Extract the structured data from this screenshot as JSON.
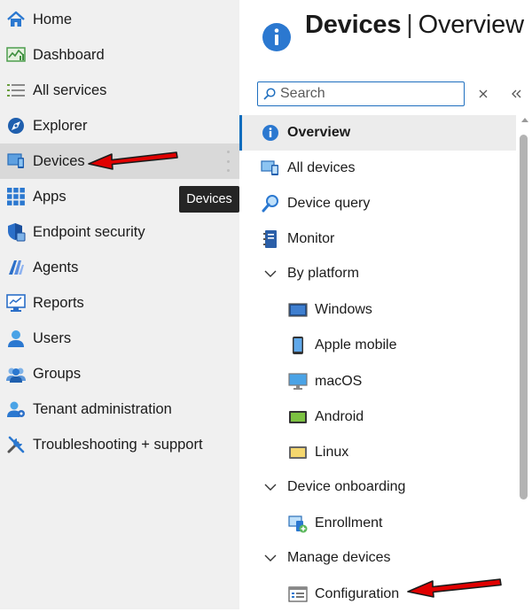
{
  "leftnav": {
    "items": [
      {
        "label": "Home",
        "icon": "home-icon"
      },
      {
        "label": "Dashboard",
        "icon": "dashboard-icon"
      },
      {
        "label": "All services",
        "icon": "all-services-icon"
      },
      {
        "label": "Explorer",
        "icon": "explorer-icon"
      },
      {
        "label": "Devices",
        "icon": "devices-icon",
        "selected": true
      },
      {
        "label": "Apps",
        "icon": "apps-icon"
      },
      {
        "label": "Endpoint security",
        "icon": "endpoint-security-icon"
      },
      {
        "label": "Agents",
        "icon": "agents-icon"
      },
      {
        "label": "Reports",
        "icon": "reports-icon"
      },
      {
        "label": "Users",
        "icon": "users-icon"
      },
      {
        "label": "Groups",
        "icon": "groups-icon"
      },
      {
        "label": "Tenant administration",
        "icon": "tenant-admin-icon"
      },
      {
        "label": "Troubleshooting + support",
        "icon": "troubleshooting-icon"
      }
    ],
    "tooltip": "Devices"
  },
  "blade": {
    "title_main": "Devices",
    "title_sep": "|",
    "title_sub": "Overview",
    "search": {
      "placeholder": "Search",
      "value": ""
    },
    "menu": {
      "overview": "Overview",
      "all_devices": "All devices",
      "device_query": "Device query",
      "monitor": "Monitor",
      "by_platform": "By platform",
      "windows": "Windows",
      "apple_mobile": "Apple mobile",
      "macos": "macOS",
      "android": "Android",
      "linux": "Linux",
      "device_onboarding": "Device onboarding",
      "enrollment": "Enrollment",
      "manage_devices": "Manage devices",
      "configuration": "Configuration"
    }
  },
  "colors": {
    "accent": "#0f6cbd",
    "selected_bg": "#d9d9d9",
    "nav_bg": "#f0f0f0",
    "annotation_arrow": "#e00000"
  }
}
